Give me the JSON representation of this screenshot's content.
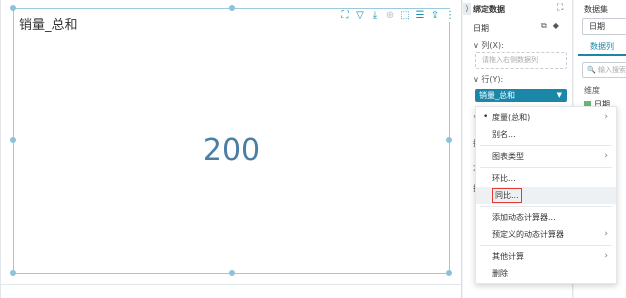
{
  "widget": {
    "title": "销量_总和",
    "value": "200",
    "toolbar_icons": [
      "fullscreen-icon",
      "filter-icon",
      "drill-icon",
      "zoom-icon",
      "linkage-icon",
      "list-icon",
      "export-icon",
      "more-icon"
    ]
  },
  "bind_panel": {
    "collapse_arrow": "⟩",
    "title": "绑定数据",
    "expand_glyph": "⛶",
    "date_field": "日期",
    "date_icons": [
      "⧉",
      "◆"
    ],
    "column_label": "∨ 列(X):",
    "column_placeholder": "请拖入右侧数据列",
    "row_label": "∨ 行(Y):",
    "row_chip": "销量_总和",
    "row_chip_caret": "▼",
    "frag_1": "∨",
    "frag_2": "指",
    "frag_3": "大",
    "frag_4": "指"
  },
  "data_panel": {
    "title": "数据集",
    "dataset_value": "日期",
    "tab_label": "数据列",
    "search_placeholder": "🔍 输入搜索",
    "dimension_label": "维度",
    "dimension_item": "日期"
  },
  "context_menu": {
    "items": [
      {
        "label": "度量(总和)",
        "bullet": "•",
        "submenu": "›"
      },
      {
        "label": "别名..."
      },
      {
        "label": "图表类型",
        "submenu": "›"
      },
      {
        "label": "环比..."
      },
      {
        "label": "同比..."
      },
      {
        "label": "添加动态计算器..."
      },
      {
        "label": "预定义的动态计算器",
        "submenu": "›"
      },
      {
        "label": "其他计算",
        "submenu": "›"
      },
      {
        "label": "删除"
      }
    ]
  }
}
